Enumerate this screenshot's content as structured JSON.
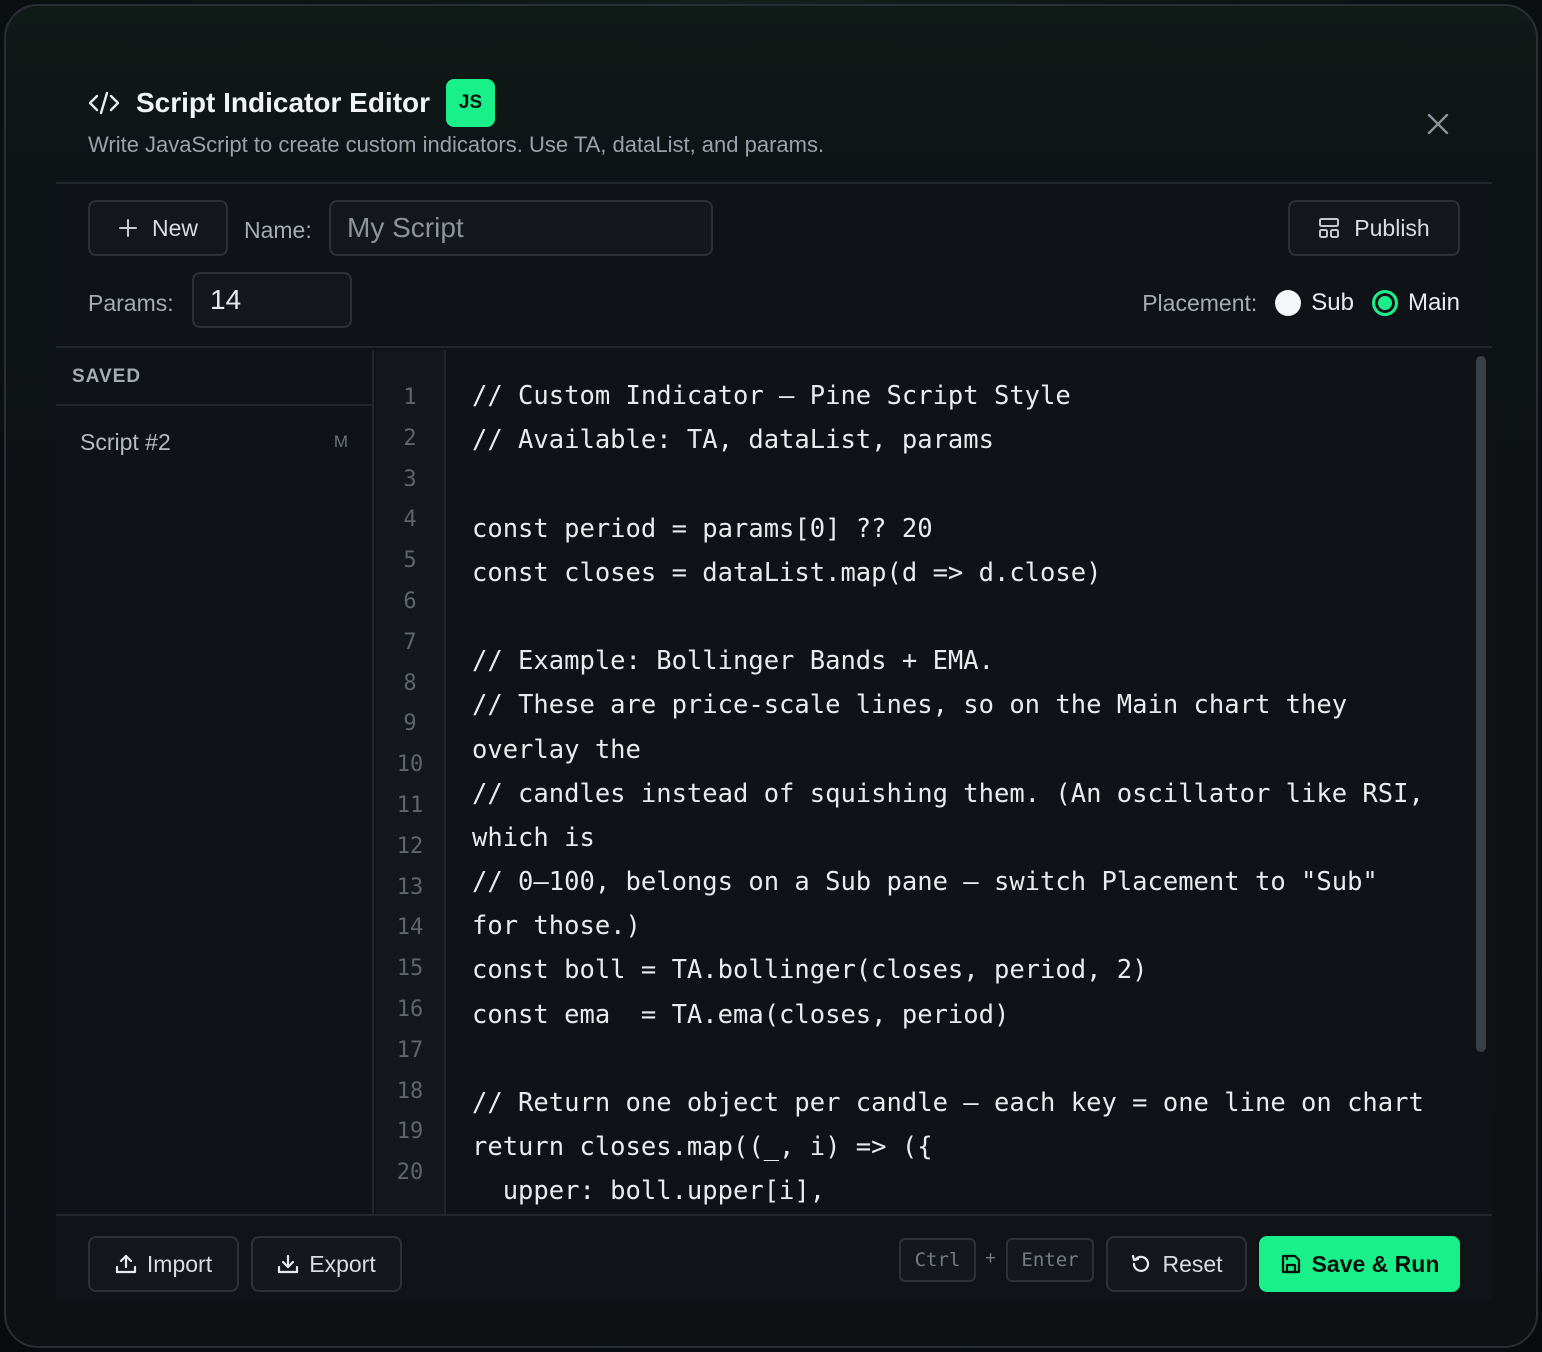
{
  "header": {
    "title": "Script Indicator Editor",
    "badge": "JS",
    "subtitle": "Write JavaScript to create custom indicators. Use TA, dataList, and params."
  },
  "toolbar": {
    "new_label": "New",
    "name_label": "Name:",
    "name_placeholder": "My Script",
    "publish_label": "Publish",
    "params_label": "Params:",
    "params_value": "14",
    "placement_label": "Placement:",
    "placement_options": [
      "Sub",
      "Main"
    ],
    "placement_selected": "Main"
  },
  "sidebar": {
    "heading": "SAVED",
    "items": [
      {
        "name": "Script #2",
        "tag": "M"
      }
    ]
  },
  "editor": {
    "line_numbers": [
      "1",
      "2",
      "3",
      "4",
      "5",
      "6",
      "7",
      "8",
      "9",
      "10",
      "11",
      "12",
      "13",
      "14",
      "15",
      "16",
      "17",
      "18",
      "19",
      "20"
    ],
    "code_lines": [
      "// Custom Indicator — Pine Script Style",
      "// Available: TA, dataList, params",
      "",
      "const period = params[0] ?? 20",
      "const closes = dataList.map(d => d.close)",
      "",
      "// Example: Bollinger Bands + EMA.",
      "// These are price-scale lines, so on the Main chart they",
      "overlay the",
      "// candles instead of squishing them. (An oscillator like RSI,",
      "which is",
      "// 0–100, belongs on a Sub pane — switch Placement to \"Sub\"",
      "for those.)",
      "const boll = TA.bollinger(closes, period, 2)",
      "const ema  = TA.ema(closes, period)",
      "",
      "// Return one object per candle — each key = one line on chart",
      "return closes.map((_, i) => ({",
      "  upper: boll.upper[i],"
    ]
  },
  "footer": {
    "import_label": "Import",
    "export_label": "Export",
    "shortcut_key1": "Ctrl",
    "shortcut_plus": "+",
    "shortcut_key2": "Enter",
    "reset_label": "Reset",
    "save_run_label": "Save & Run"
  },
  "colors": {
    "accent": "#19f08a",
    "background": "#0f1216"
  }
}
